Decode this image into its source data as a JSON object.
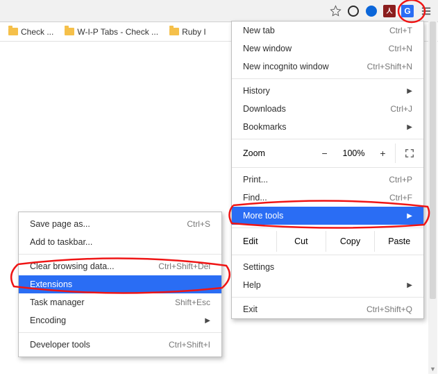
{
  "toolbar": {
    "icons": [
      "star-icon",
      "ghostery-icon",
      "opera-icon",
      "pdf-icon",
      "translate-icon",
      "menu-icon"
    ]
  },
  "bookmarks": [
    {
      "label": "Check ..."
    },
    {
      "label": "W-I-P Tabs - Check ..."
    },
    {
      "label": "Ruby I"
    }
  ],
  "menu": {
    "new_tab": "New tab",
    "new_tab_sc": "Ctrl+T",
    "new_win": "New window",
    "new_win_sc": "Ctrl+N",
    "incog": "New incognito window",
    "incog_sc": "Ctrl+Shift+N",
    "history": "History",
    "downloads": "Downloads",
    "downloads_sc": "Ctrl+J",
    "bookmarks": "Bookmarks",
    "zoom_label": "Zoom",
    "zoom_val": "100%",
    "print": "Print...",
    "print_sc": "Ctrl+P",
    "find": "Find...",
    "find_sc": "Ctrl+F",
    "more_tools": "More tools",
    "edit_label": "Edit",
    "cut": "Cut",
    "copy": "Copy",
    "paste": "Paste",
    "settings": "Settings",
    "help": "Help",
    "exit": "Exit",
    "exit_sc": "Ctrl+Shift+Q"
  },
  "sub": {
    "save_as": "Save page as...",
    "save_as_sc": "Ctrl+S",
    "add_tb": "Add to taskbar...",
    "clear": "Clear browsing data...",
    "clear_sc": "Ctrl+Shift+Del",
    "ext": "Extensions",
    "task": "Task manager",
    "task_sc": "Shift+Esc",
    "enc": "Encoding",
    "dev": "Developer tools",
    "dev_sc": "Ctrl+Shift+I"
  }
}
